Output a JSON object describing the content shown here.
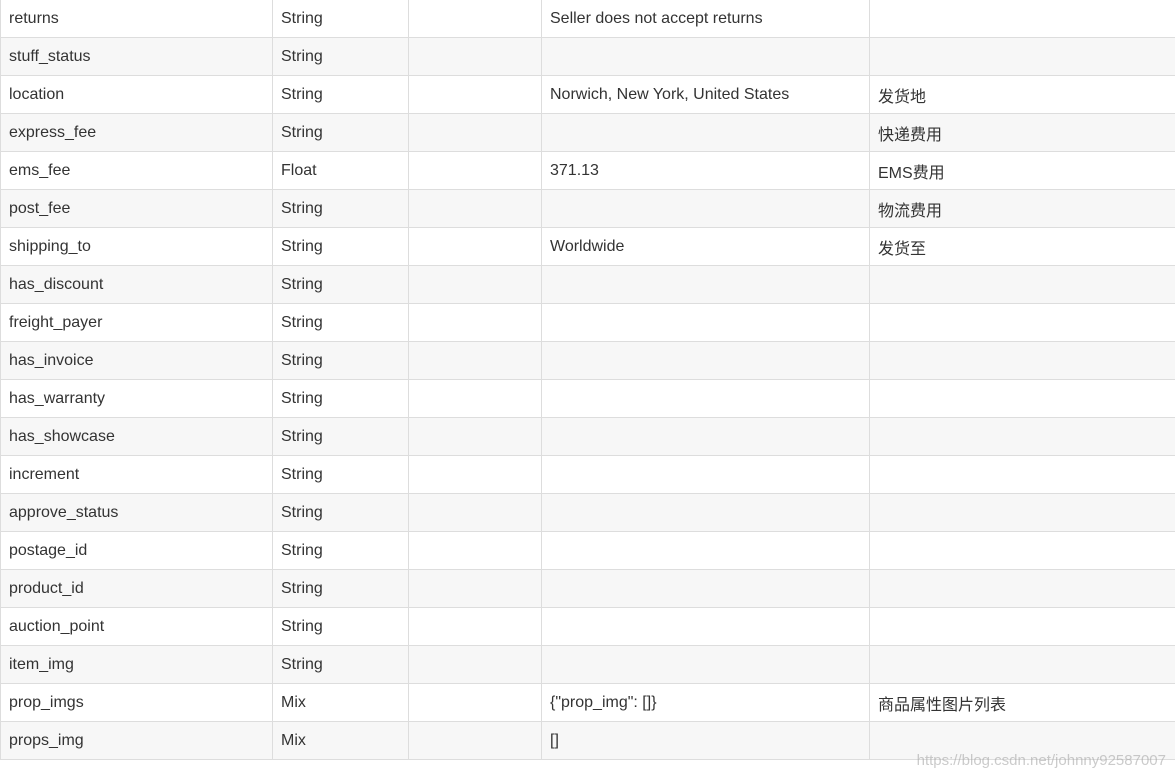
{
  "table": {
    "rows": [
      {
        "name": "returns",
        "type": "String",
        "sample": "",
        "value": "Seller does not accept returns",
        "desc": ""
      },
      {
        "name": "stuff_status",
        "type": "String",
        "sample": "",
        "value": "",
        "desc": ""
      },
      {
        "name": "location",
        "type": "String",
        "sample": "",
        "value": "Norwich, New York, United States",
        "desc": "发货地"
      },
      {
        "name": "express_fee",
        "type": "String",
        "sample": "",
        "value": "",
        "desc": "快递费用"
      },
      {
        "name": "ems_fee",
        "type": "Float",
        "sample": "",
        "value": "371.13",
        "desc": "EMS费用"
      },
      {
        "name": "post_fee",
        "type": "String",
        "sample": "",
        "value": "",
        "desc": "物流费用"
      },
      {
        "name": "shipping_to",
        "type": "String",
        "sample": "",
        "value": "Worldwide",
        "desc": "发货至"
      },
      {
        "name": "has_discount",
        "type": "String",
        "sample": "",
        "value": "",
        "desc": ""
      },
      {
        "name": "freight_payer",
        "type": "String",
        "sample": "",
        "value": "",
        "desc": ""
      },
      {
        "name": "has_invoice",
        "type": "String",
        "sample": "",
        "value": "",
        "desc": ""
      },
      {
        "name": "has_warranty",
        "type": "String",
        "sample": "",
        "value": "",
        "desc": ""
      },
      {
        "name": "has_showcase",
        "type": "String",
        "sample": "",
        "value": "",
        "desc": ""
      },
      {
        "name": "increment",
        "type": "String",
        "sample": "",
        "value": "",
        "desc": ""
      },
      {
        "name": "approve_status",
        "type": "String",
        "sample": "",
        "value": "",
        "desc": ""
      },
      {
        "name": "postage_id",
        "type": "String",
        "sample": "",
        "value": "",
        "desc": ""
      },
      {
        "name": "product_id",
        "type": "String",
        "sample": "",
        "value": "",
        "desc": ""
      },
      {
        "name": "auction_point",
        "type": "String",
        "sample": "",
        "value": "",
        "desc": ""
      },
      {
        "name": "item_img",
        "type": "String",
        "sample": "",
        "value": "",
        "desc": ""
      },
      {
        "name": "prop_imgs",
        "type": "Mix",
        "sample": "",
        "value": "{\"prop_img\": []}",
        "desc": "商品属性图片列表"
      },
      {
        "name": "props_img",
        "type": "Mix",
        "sample": "",
        "value": "[]",
        "desc": ""
      }
    ]
  },
  "watermark": "https://blog.csdn.net/johnny92587007"
}
